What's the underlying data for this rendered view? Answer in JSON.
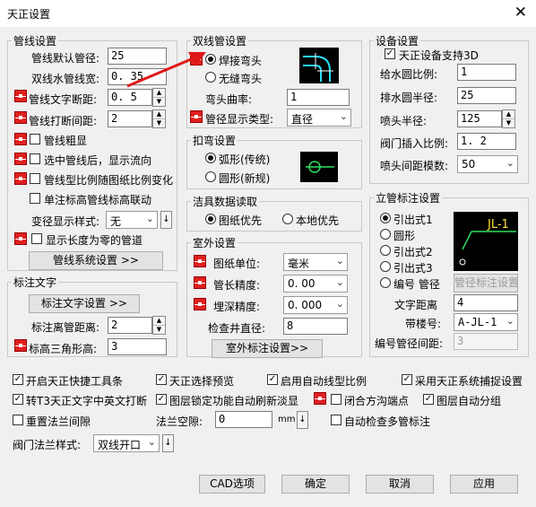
{
  "window": {
    "title": "天正设置"
  },
  "pipe_settings": {
    "legend": "管线设置",
    "default_dia_label": "管线默认管径:",
    "default_dia_value": "25",
    "double_width_label": "双线水管线宽:",
    "double_width_value": "0. 35",
    "text_gap_label": "管线文字断距:",
    "text_gap_value": "0. 5",
    "break_gap_label": "管线打断间距:",
    "break_gap_value": "2",
    "bold_label": "管线粗显",
    "flow_label": "选中管线后，显示流向",
    "scale_label": "管线型比例随图纸比例变化",
    "elev_label": "单注标高管线标高联动",
    "var_style_label": "变径显示样式:",
    "var_style_value": "无",
    "zero_len_label": "显示长度为零的管道",
    "settings_button": "管线系统设置 >>"
  },
  "double_pipe": {
    "legend": "双线管设置",
    "weld_label": "焊接弯头",
    "seamless_label": "无缝弯头",
    "bend_curvature_label": "弯头曲率:",
    "bend_curvature_value": "1",
    "dia_display_label": "管径显示类型:",
    "dia_display_value": "直径"
  },
  "bend": {
    "legend": "扣弯设置",
    "arc_label": "弧形(传统)",
    "circle_label": "圆形(新规)"
  },
  "fixture": {
    "legend": "洁具数据读取",
    "drawing_first_label": "图纸优先",
    "local_first_label": "本地优先"
  },
  "outdoor": {
    "legend": "室外设置",
    "unit_label": "图纸单位:",
    "unit_value": "毫米",
    "pipe_len_label": "管长精度:",
    "pipe_len_value": "0. 00",
    "depth_label": "埋深精度:",
    "depth_value": "0. 000",
    "well_dia_label": "检查井直径:",
    "well_dia_value": "8",
    "label_button": "室外标注设置>>"
  },
  "equipment": {
    "legend": "设备设置",
    "support3d_label": "天正设备支持3D",
    "supply_scale_label": "给水圆比例:",
    "supply_scale_value": "1",
    "drain_radius_label": "排水圆半径:",
    "drain_radius_value": "25",
    "spray_radius_label": "喷头半径:",
    "spray_radius_value": "125",
    "valve_scale_label": "阀门插入比例:",
    "valve_scale_value": "1. 2",
    "spray_spacing_label": "喷头间距模数:",
    "spray_spacing_value": "50"
  },
  "vertical": {
    "legend": "立管标注设置",
    "lead1_label": "引出式1",
    "circle_label": "圆形",
    "lead2_label": "引出式2",
    "lead3_label": "引出式3",
    "number_pipe_label": "编号 管径",
    "settings_button": "管径标注设置",
    "text_dist_label": "文字距离",
    "text_dist_value": "4",
    "with_num_label": "带楼号:",
    "with_num_value": "A-JL-1",
    "num_gap_label": "编号管径间距:",
    "num_gap_value": "3",
    "preview_text": "JL-1"
  },
  "text_label": {
    "legend": "标注文字",
    "settings_button": "标注文字设置 >>",
    "from_pipe_label": "标注离管距离:",
    "from_pipe_value": "2",
    "triangle_label": "标高三角形高:",
    "triangle_value": "3"
  },
  "bottom": {
    "opt_toolbar": "开启天正快捷工具条",
    "opt_preview": "天正选择预览",
    "opt_auto_ltscale": "启用自动线型比例",
    "opt_snap": "采用天正系统捕捉设置",
    "opt_t3_break": "转T3天正文字中英文打断",
    "opt_layer_lock": "图层锁定功能自动刷新淡显",
    "opt_closed_ditch": "闭合方沟端点",
    "opt_layer_auto": "图层自动分组",
    "opt_reset_flange": "重置法兰间隙",
    "flange_gap_label": "法兰空隙:",
    "flange_gap_value": "0",
    "flange_gap_unit": "mm",
    "opt_auto_multi": "自动检查多管标注",
    "valve_flange_label": "阀门法兰样式:",
    "valve_flange_value": "双线开口"
  },
  "footer": {
    "cad_button": "CAD选项",
    "ok_button": "确定",
    "cancel_button": "取消",
    "apply_button": "应用"
  }
}
